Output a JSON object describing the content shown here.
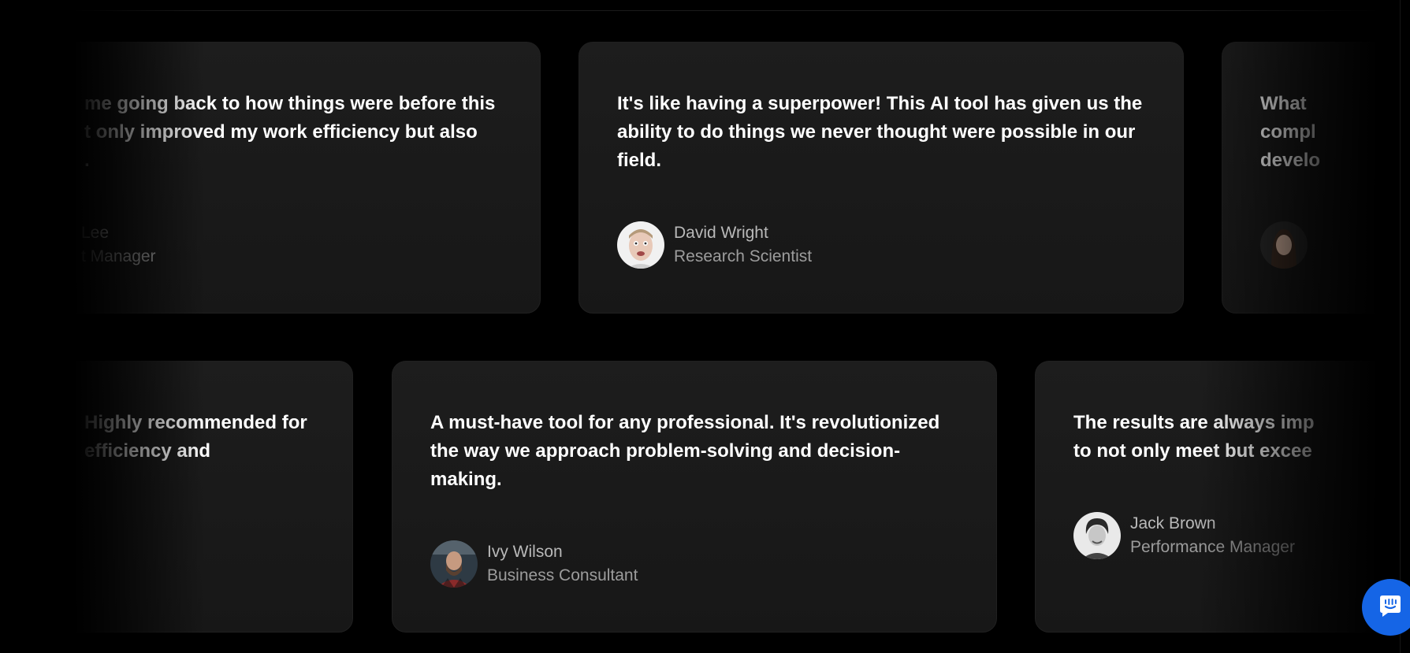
{
  "testimonials": {
    "row1": [
      {
        "quote_lines": [
          "me going back to how things were before this",
          "t only improved my work efficiency but also",
          "."
        ],
        "name": "Lee",
        "role": "t Manager"
      },
      {
        "quote": "It's like having a superpower! This AI tool has given us the ability to do things we never thought were possible in our field.",
        "name": "David Wright",
        "role": "Research Scientist"
      },
      {
        "quote_lines": [
          "What",
          "compl",
          "develo"
        ],
        "name": "",
        "role": ""
      }
    ],
    "row2": [
      {
        "quote_lines": [
          "Highly recommended for",
          "efficiency and"
        ],
        "name": "",
        "role": ""
      },
      {
        "quote": "A must-have tool for any professional. It's revolutionized the way we approach problem-solving and decision-making.",
        "name": "Ivy Wilson",
        "role": "Business Consultant"
      },
      {
        "quote_lines": [
          "The results are always imp",
          "to not only meet but excee"
        ],
        "name": "Jack Brown",
        "role": "Performance Manager"
      }
    ]
  },
  "icons": {
    "chat_launcher": "chat-bubble-icon"
  },
  "colors": {
    "background": "#000000",
    "card": "#1b1b1b",
    "quote_text": "#ffffff",
    "author_text": "#b9b9b9",
    "launcher": "#1565e6"
  }
}
